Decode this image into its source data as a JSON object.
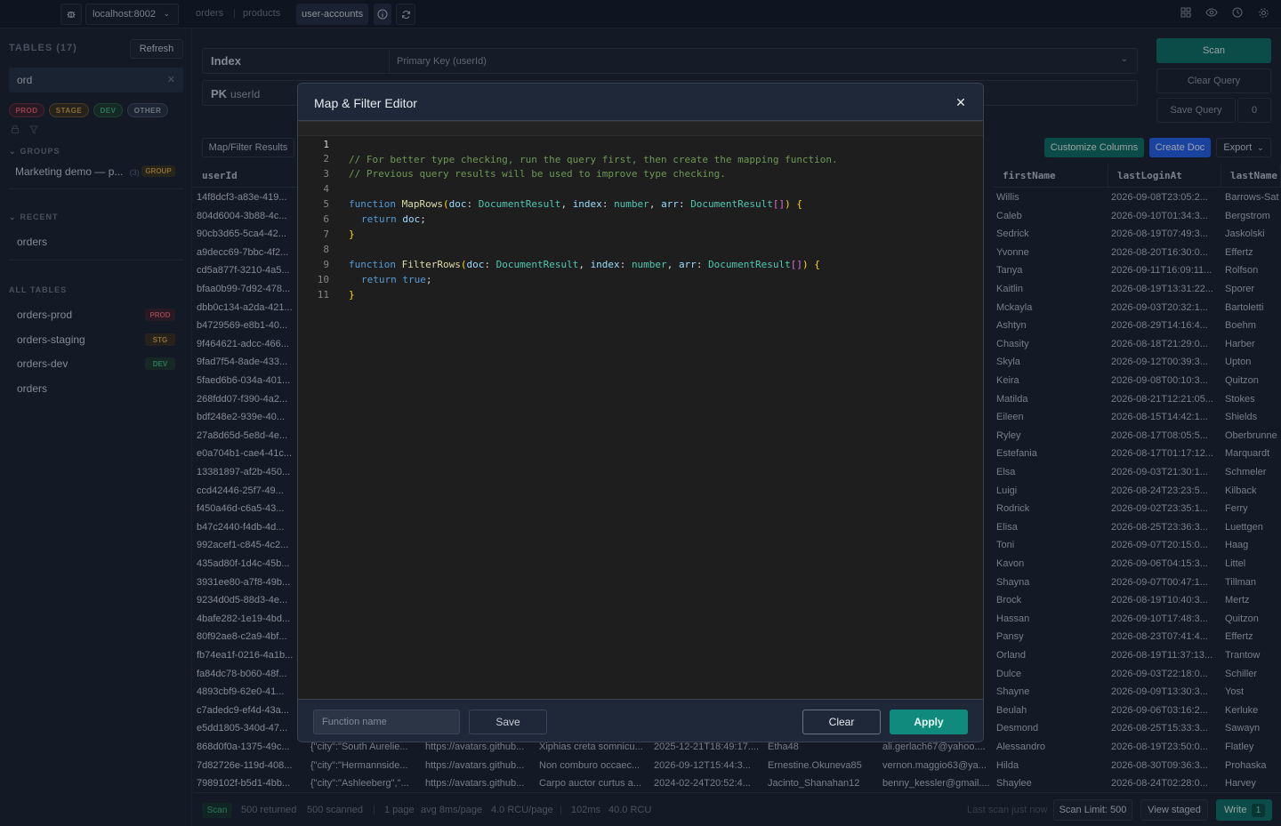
{
  "topbar": {
    "host": "localhost:8002",
    "crumbs": [
      "orders",
      "products"
    ],
    "active_tab": "user-accounts"
  },
  "sidebar": {
    "tables_title": "TABLES (17)",
    "refresh_label": "Refresh",
    "search_value": "ord",
    "env_pills": [
      "PROD",
      "STAGE",
      "DEV",
      "OTHER"
    ],
    "groups_title": "GROUPS",
    "group": {
      "name": "Marketing demo — p...",
      "count": "(3)",
      "badge": "GROUP"
    },
    "recent_title": "RECENT",
    "recent": [
      "orders"
    ],
    "all_title": "ALL TABLES",
    "all_tables": [
      {
        "name": "orders-prod",
        "tag": "PROD"
      },
      {
        "name": "orders-staging",
        "tag": "STG"
      },
      {
        "name": "orders-dev",
        "tag": "DEV"
      },
      {
        "name": "orders",
        "tag": ""
      }
    ]
  },
  "query": {
    "index_label": "Index",
    "index_value": "Primary Key (userId)",
    "pk_label": "PK",
    "pk_field": "userId",
    "scan_label": "Scan",
    "clear_label": "Clear Query",
    "save_label": "Save Query",
    "save_count": "0"
  },
  "toolbar": {
    "map_filter": "Map/Filter Results",
    "customize": "Customize Columns",
    "create_doc": "Create Doc",
    "export": "Export"
  },
  "table": {
    "headers": [
      "userId",
      "firstName",
      "lastLoginAt",
      "lastName"
    ],
    "rows": [
      [
        "14f8dcf3-a83e-419...",
        "Willis",
        "2026-09-08T23:05:2...",
        "Barrows-Sat"
      ],
      [
        "804d6004-3b88-4c...",
        "Caleb",
        "2026-09-10T01:34:3...",
        "Bergstrom"
      ],
      [
        "90cb3d65-5ca4-42...",
        "Sedrick",
        "2026-08-19T07:49:3...",
        "Jaskolski"
      ],
      [
        "a9decc69-7bbc-4f2...",
        "Yvonne",
        "2026-08-20T16:30:0...",
        "Effertz"
      ],
      [
        "cd5a877f-3210-4a5...",
        "Tanya",
        "2026-09-11T16:09:11...",
        "Rolfson"
      ],
      [
        "bfaa0b99-7d92-478...",
        "Kaitlin",
        "2026-08-19T13:31:22...",
        "Sporer"
      ],
      [
        "dbb0c134-a2da-421...",
        "Mckayla",
        "2026-09-03T20:32:1...",
        "Bartoletti"
      ],
      [
        "b4729569-e8b1-40...",
        "Ashtyn",
        "2026-08-29T14:16:4...",
        "Boehm"
      ],
      [
        "9f464621-adcc-466...",
        "Chasity",
        "2026-08-18T21:29:0...",
        "Harber"
      ],
      [
        "9fad7f54-8ade-433...",
        "Skyla",
        "2026-09-12T00:39:3...",
        "Upton"
      ],
      [
        "5faed6b6-034a-401...",
        "Keira",
        "2026-09-08T00:10:3...",
        "Quitzon"
      ],
      [
        "268fdd07-f390-4a2...",
        "Matilda",
        "2026-08-21T12:21:05...",
        "Stokes"
      ],
      [
        "bdf248e2-939e-40...",
        "Eileen",
        "2026-08-15T14:42:1...",
        "Shields"
      ],
      [
        "27a8d65d-5e8d-4e...",
        "Ryley",
        "2026-08-17T08:05:5...",
        "Oberbrunne"
      ],
      [
        "e0a704b1-cae4-41c...",
        "Estefania",
        "2026-08-17T01:17:12...",
        "Marquardt"
      ],
      [
        "13381897-af2b-450...",
        "Elsa",
        "2026-09-03T21:30:1...",
        "Schmeler"
      ],
      [
        "ccd42446-25f7-49...",
        "Luigi",
        "2026-08-24T23:23:5...",
        "Kilback"
      ],
      [
        "f450a46d-c6a5-43...",
        "Rodrick",
        "2026-09-02T23:35:1...",
        "Ferry"
      ],
      [
        "b47c2440-f4db-4d...",
        "Elisa",
        "2026-08-25T23:36:3...",
        "Luettgen"
      ],
      [
        "992acef1-c845-4c2...",
        "Toni",
        "2026-09-07T20:15:0...",
        "Haag"
      ],
      [
        "435ad80f-1d4c-45b...",
        "Kavon",
        "2026-09-06T04:15:3...",
        "Littel"
      ],
      [
        "3931ee80-a7f8-49b...",
        "Shayna",
        "2026-09-07T00:47:1...",
        "Tillman"
      ],
      [
        "9234d0d5-88d3-4e...",
        "Brock",
        "2026-08-19T10:40:3...",
        "Mertz"
      ],
      [
        "4bafe282-1e19-4bd...",
        "Hassan",
        "2026-09-10T17:48:3...",
        "Quitzon"
      ],
      [
        "80f92ae8-c2a9-4bf...",
        "Pansy",
        "2026-08-23T07:41:4...",
        "Effertz"
      ],
      [
        "fb74ea1f-0216-4a1b...",
        "Orland",
        "2026-08-19T11:37:13...",
        "Trantow"
      ],
      [
        "fa84dc78-b060-48f...",
        "Dulce",
        "2026-09-03T22:18:0...",
        "Schiller"
      ],
      [
        "4893cbf9-62e0-41...",
        "Shayne",
        "2026-09-09T13:30:3...",
        "Yost"
      ],
      [
        "c7adedc9-ef4d-43a...",
        "Beulah",
        "2026-09-06T03:16:2...",
        "Kerluke"
      ],
      [
        "e5dd1805-340d-47...",
        "Desmond",
        "2026-08-25T15:33:3...",
        "Sawayn"
      ]
    ],
    "full_rows": [
      [
        "868d0f0a-1375-49c...",
        "{\"city\":\"South Aurelie...",
        "https://avatars.github...",
        "Xiphias creta somnicu...",
        "2025-12-21T18:49:17....",
        "Etha48",
        "ali.gerlach67@yahoo....",
        "Alessandro",
        "2026-08-19T23:50:0...",
        "Flatley"
      ],
      [
        "7d82726e-119d-408...",
        "{\"city\":\"Hermannside...",
        "https://avatars.github...",
        "Non comburo occaec...",
        "2026-09-12T15:44:3...",
        "Ernestine.Okuneva85",
        "vernon.maggio63@ya...",
        "Hilda",
        "2026-08-30T09:36:3...",
        "Prohaska"
      ],
      [
        "7989102f-b5d1-4bb...",
        "{\"city\":\"Ashleeberg\",\"...",
        "https://avatars.github...",
        "Carpo auctor curtus a...",
        "2024-02-24T20:52:4...",
        "Jacinto_Shanahan12",
        "benny_kessler@gmail....",
        "Shaylee",
        "2026-08-24T02:28:0...",
        "Harvey"
      ]
    ]
  },
  "status": {
    "mode": "Scan",
    "returned": "500 returned",
    "scanned": "500 scanned",
    "page": "1 page",
    "avg": "avg 8ms/page",
    "rcu_page": "4.0 RCU/page",
    "ms": "102ms",
    "rcu": "40.0 RCU",
    "last_scan": "Last scan just now",
    "scan_limit": "Scan Limit: 500",
    "view_staged": "View staged",
    "write": "Write",
    "write_count": "1"
  },
  "modal": {
    "title": "Map & Filter Editor",
    "line_numbers": [
      "1",
      "2",
      "3",
      "4",
      "5",
      "6",
      "7",
      "8",
      "9",
      "10",
      "11"
    ],
    "code": {
      "l1": "// For better type checking, run the query first, then create the mapping function.",
      "l2": "// Previous query results will be used to improve type checking.",
      "kw_function": "function",
      "map_name": "MapRows",
      "filter_name": "FilterRows",
      "p_doc": "doc",
      "p_index": "index",
      "p_arr": "arr",
      "t_doc": "DocumentResult",
      "t_num": "number",
      "t_arr": "DocumentResult",
      "kw_return": "return",
      "ret_doc": "doc",
      "ret_true": "true"
    },
    "fn_placeholder": "Function name",
    "save_label": "Save",
    "clear_label": "Clear",
    "apply_label": "Apply"
  },
  "colors": {
    "accent_teal": "#0f8a7c",
    "accent_blue": "#2563eb",
    "prod": "#e0626b",
    "stage": "#d2a24c",
    "dev": "#3fb27f"
  }
}
